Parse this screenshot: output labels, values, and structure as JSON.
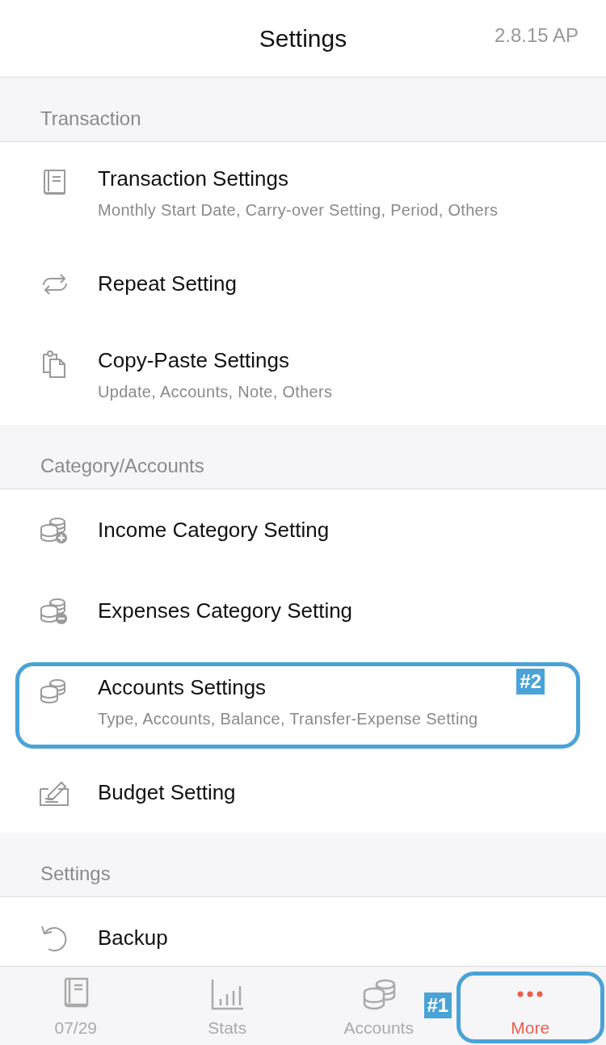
{
  "header": {
    "title": "Settings",
    "version": "2.8.15 AP"
  },
  "sections": [
    {
      "title": "Transaction",
      "items": [
        {
          "title": "Transaction Settings",
          "subtitle": "Monthly Start Date, Carry-over Setting, Period, Others"
        },
        {
          "title": "Repeat Setting"
        },
        {
          "title": "Copy-Paste Settings",
          "subtitle": "Update, Accounts, Note, Others"
        }
      ]
    },
    {
      "title": "Category/Accounts",
      "items": [
        {
          "title": "Income Category Setting"
        },
        {
          "title": "Expenses Category Setting"
        },
        {
          "title": "Accounts Settings",
          "subtitle": "Type, Accounts, Balance, Transfer-Expense Setting",
          "callout": "#2"
        },
        {
          "title": "Budget Setting"
        }
      ]
    },
    {
      "title": "Settings",
      "items": [
        {
          "title": "Backup"
        }
      ]
    }
  ],
  "tabs": [
    {
      "label": "07/29",
      "selected": false
    },
    {
      "label": "Stats",
      "selected": false
    },
    {
      "label": "Accounts",
      "selected": false
    },
    {
      "label": "More",
      "selected": true,
      "callout": "#1"
    }
  ]
}
